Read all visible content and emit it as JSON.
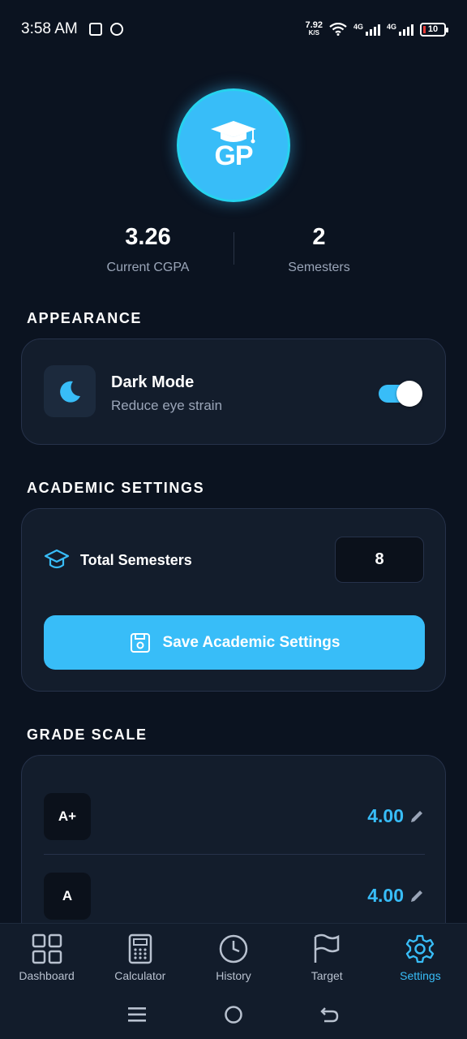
{
  "status_bar": {
    "time": "3:58 AM",
    "net_speed": "7.92",
    "net_unit": "K/S",
    "network_1": "4G",
    "network_2": "4G",
    "battery": "10"
  },
  "profile": {
    "logo_text": "GP",
    "cgpa_value": "3.26",
    "cgpa_label": "Current CGPA",
    "semesters_value": "2",
    "semesters_label": "Semesters"
  },
  "appearance": {
    "section_title": "APPEARANCE",
    "dark_mode_title": "Dark Mode",
    "dark_mode_subtitle": "Reduce eye strain",
    "dark_mode_enabled": true
  },
  "academic": {
    "section_title": "ACADEMIC SETTINGS",
    "total_semesters_label": "Total Semesters",
    "total_semesters_value": "8",
    "save_label": "Save Academic Settings"
  },
  "grade_scale": {
    "section_title": "GRADE SCALE",
    "rows": [
      {
        "grade": "A+",
        "value": "4.00"
      },
      {
        "grade": "A",
        "value": "4.00"
      }
    ]
  },
  "nav": {
    "items": [
      {
        "label": "Dashboard",
        "icon": "grid-icon"
      },
      {
        "label": "Calculator",
        "icon": "calculator-icon"
      },
      {
        "label": "History",
        "icon": "clock-icon"
      },
      {
        "label": "Target",
        "icon": "flag-icon"
      },
      {
        "label": "Settings",
        "icon": "gear-icon"
      }
    ],
    "active": "Settings"
  },
  "colors": {
    "background": "#0b1320",
    "card": "#131d2c",
    "accent": "#38bdf8",
    "muted_text": "#9aa5b8"
  }
}
